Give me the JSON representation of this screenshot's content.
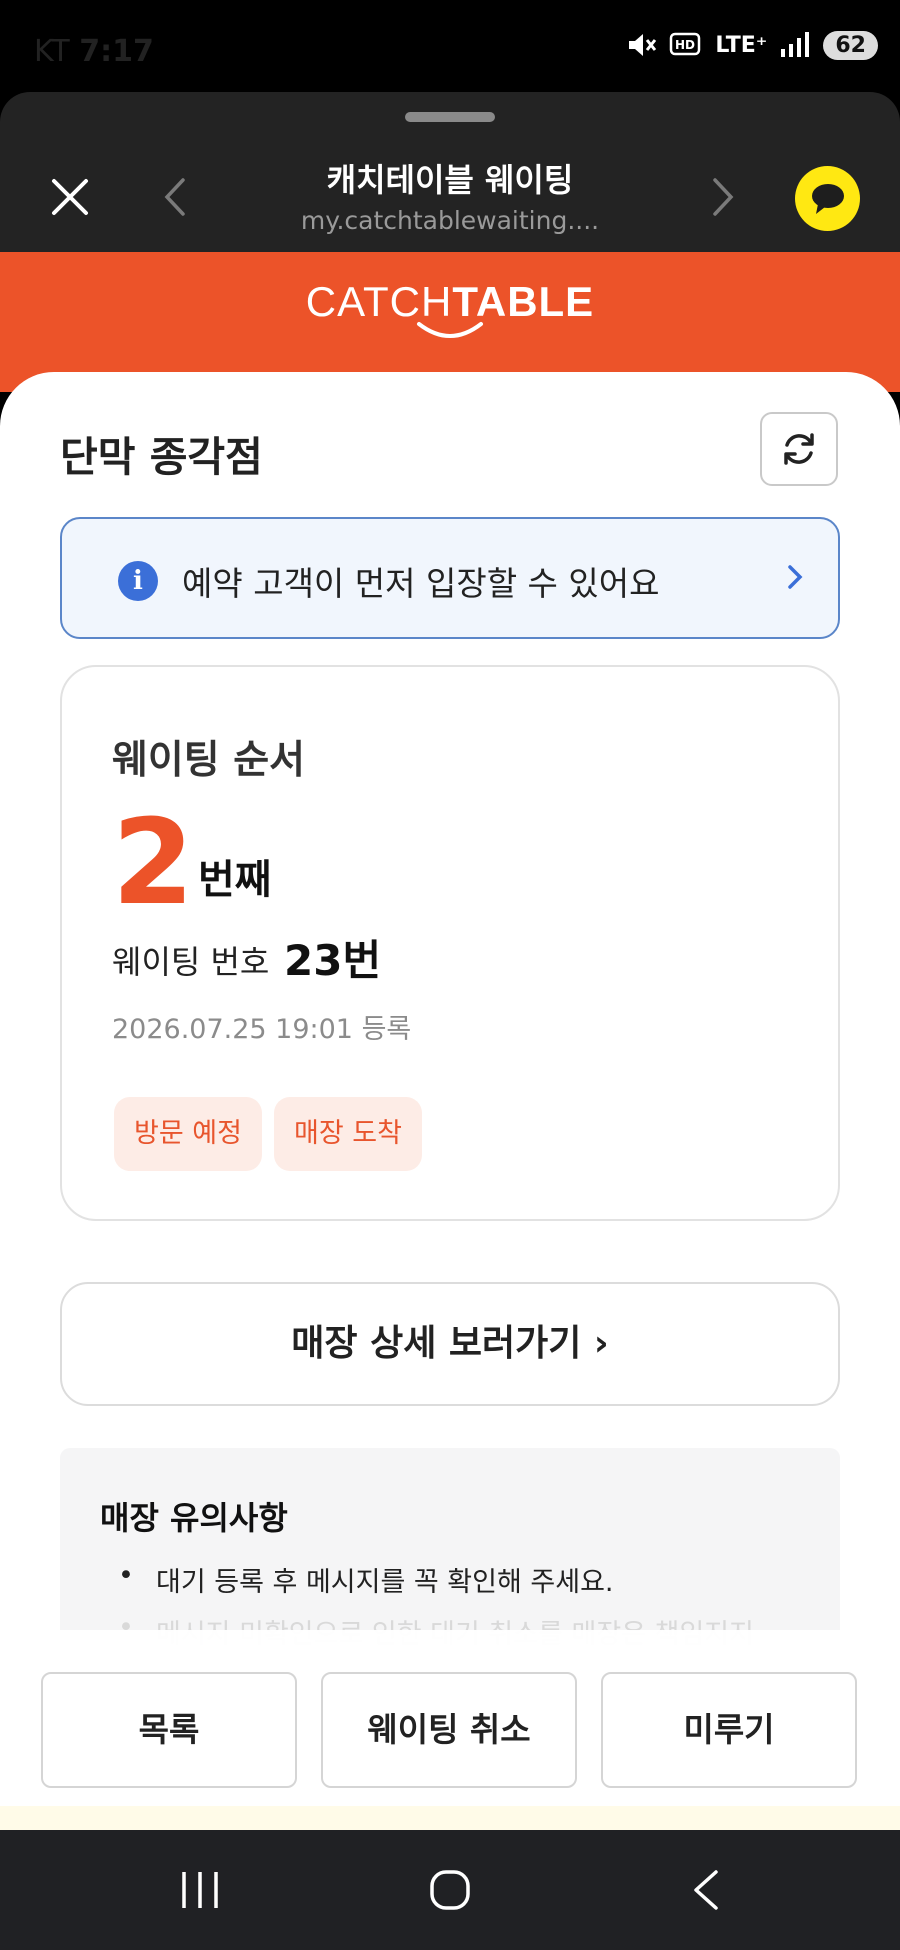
{
  "status_bar": {
    "carrier": "KT",
    "time": "7:17",
    "network": "LTE⁺",
    "battery": "62"
  },
  "browser": {
    "title": "캐치테이블 웨이팅",
    "url": "my.catchtablewaiting...."
  },
  "brand": {
    "logo_light": "CATCH",
    "logo_bold": "TABLE",
    "accent": "#ec5329"
  },
  "store": {
    "name": "단막 종각점"
  },
  "notice": {
    "text": "예약 고객이 먼저 입장할 수 있어요"
  },
  "waiting": {
    "label": "웨이팅 순서",
    "order": "2",
    "order_unit": "번째",
    "number_label": "웨이팅 번호",
    "number_value": "23번",
    "registered": "2026.07.25 19:01 등록",
    "chips": [
      "방문 예정",
      "매장 도착"
    ]
  },
  "detail_button": "매장 상세 보러가기 ›",
  "notes": {
    "title": "매장 유의사항",
    "items": [
      "대기 등록 후 메시지를 꼭 확인해 주세요.",
      "메시지 미확인으로 인한 대기 취소를 매장은 책임지지"
    ]
  },
  "actions": {
    "list": "목록",
    "cancel": "웨이팅 취소",
    "delay": "미루기"
  },
  "icons": {
    "close": "close-icon",
    "back": "chevron-left-icon",
    "forward": "chevron-right-icon",
    "kakao": "kakao-chat-icon",
    "refresh": "refresh-icon",
    "info": "info-icon"
  }
}
